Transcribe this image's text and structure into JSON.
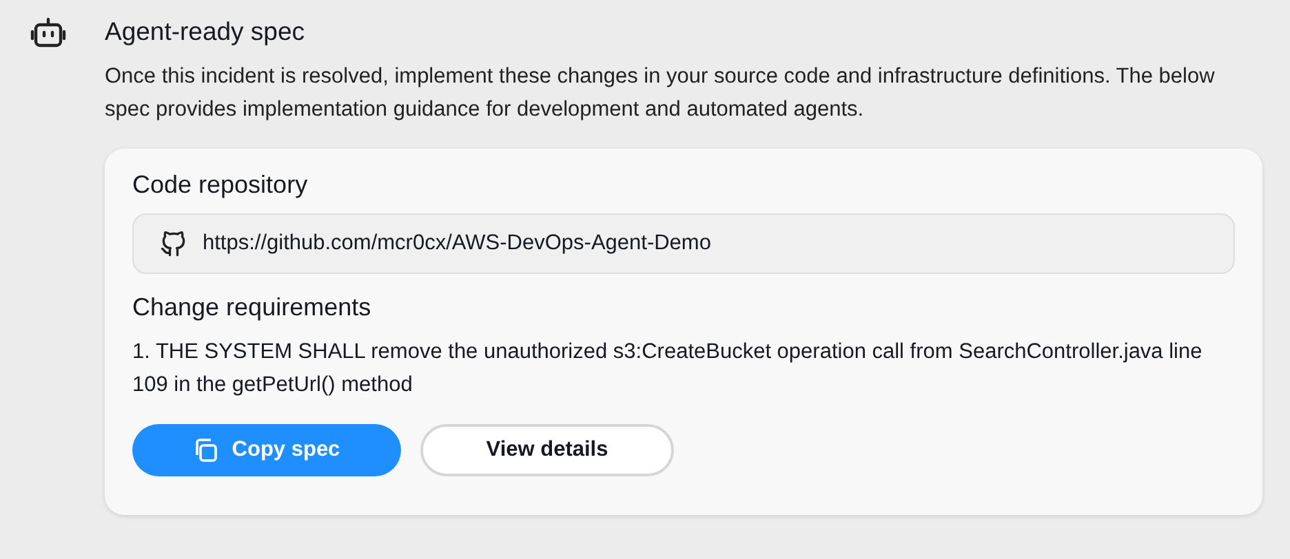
{
  "section": {
    "title": "Agent-ready spec",
    "description": "Once this incident is resolved, implement these changes in your source code and infrastructure definitions. The below spec provides implementation guidance for development and automated agents."
  },
  "card": {
    "repository_heading": "Code repository",
    "repository_url": "https://github.com/mcr0cx/AWS-DevOps-Agent-Demo",
    "requirements_heading": "Change requirements",
    "requirements": [
      "1. THE SYSTEM SHALL remove the unauthorized s3:CreateBucket operation call from SearchController.java line 109 in the getPetUrl() method"
    ],
    "buttons": [
      {
        "label": "Copy spec",
        "kind": "primary"
      },
      {
        "label": "View details",
        "kind": "secondary"
      }
    ]
  }
}
